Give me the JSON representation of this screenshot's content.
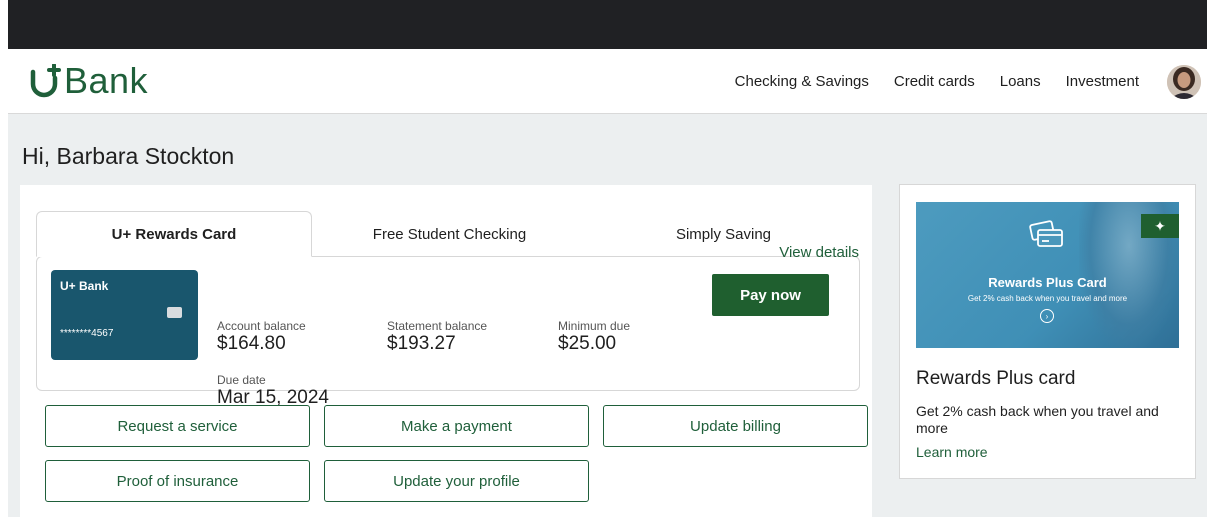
{
  "brand": {
    "name": "Bank",
    "color": "#1f5f3a"
  },
  "nav": {
    "links": [
      "Checking & Savings",
      "Credit cards",
      "Loans",
      "Investment"
    ]
  },
  "greeting": "Hi, Barbara Stockton",
  "tabs": [
    "U+ Rewards Card",
    "Free Student Checking",
    "Simply Saving"
  ],
  "card": {
    "bank": "U+ Bank",
    "number": "********4567",
    "color": "#19566d"
  },
  "account": {
    "balance_label": "Account balance",
    "balance": "$164.80",
    "statement_label": "Statement balance",
    "statement": "$193.27",
    "min_due_label": "Minimum due",
    "min_due": "$25.00",
    "due_date_label": "Due date",
    "due_date": "Mar 15, 2024",
    "view_details": "View details",
    "pay_now": "Pay now"
  },
  "actions": [
    "Request a service",
    "Make a payment",
    "Update billing",
    "Proof of insurance",
    "Update your profile"
  ],
  "promo": {
    "image_title": "Rewards Plus Card",
    "image_subtitle": "Get 2% cash back when you travel and more",
    "title": "Rewards Plus card",
    "description": "Get 2% cash back when you travel and more",
    "link": "Learn more"
  }
}
